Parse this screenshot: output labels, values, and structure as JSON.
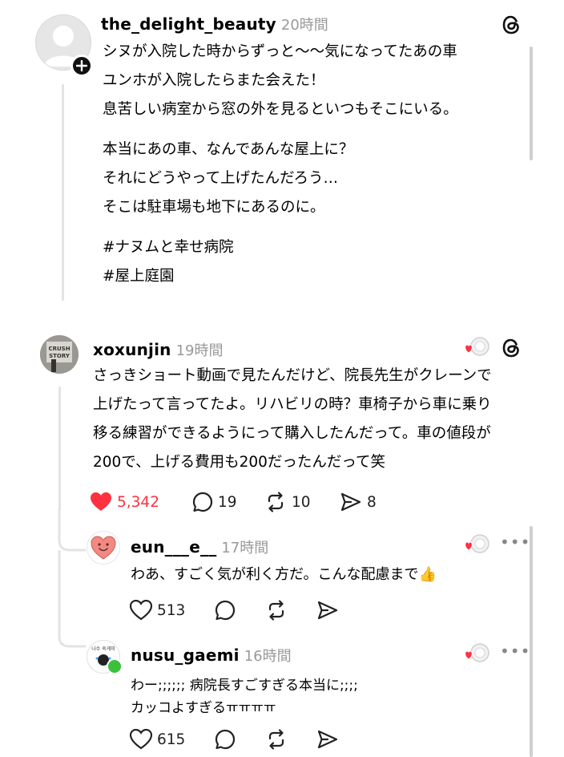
{
  "post": {
    "username": "the_delight_beauty",
    "time": "20時間",
    "paragraphs": [
      [
        "シヌが入院した時からずっと〜〜気になってたあの車",
        "ユンホが入院したらまた会えた！",
        "息苦しい病室から窓の外を見るといつもそこにいる。"
      ],
      [
        "本当にあの車、なんであんな屋上に？",
        "それにどうやって上げたんだろう…",
        "そこは駐車場も地下にあるのに。"
      ],
      [
        "#ナヌムと幸せ病院",
        "#屋上庭園"
      ]
    ]
  },
  "comment": {
    "username": "xoxunjin",
    "time": "19時間",
    "avatar_text": "CRUSH STORY",
    "lines": [
      "さっきショート動画で見たんだけど、院長先生がクレーンで",
      "上げたって言ってたよ。リハビリの時？車椅子から車に乗り",
      "移る練習ができるようにって購入したんだって。車の値段が",
      "200で、上げる費用も200だったんだって笑"
    ],
    "likes": "5,342",
    "replies": "19",
    "reposts": "10",
    "shares": "8"
  },
  "replies": [
    {
      "username": "eun___e__",
      "time": "17時間",
      "lines": [
        "わあ、すごく気が利く方だ。こんな配慮まで👍"
      ],
      "likes": "513"
    },
    {
      "username": "nusu_gaemi",
      "time": "16時間",
      "avatar_text": "나수 숙게미",
      "lines": [
        "わー;;;;;;  病院長すごすぎる本当に;;;;",
        "カッコよすぎるㅠㅠㅠㅠ"
      ],
      "likes": "615"
    }
  ],
  "icons": {
    "threads_logo": "threads-icon",
    "heart": "heart-icon",
    "reply": "reply-icon",
    "repost": "repost-icon",
    "share": "share-icon",
    "more": "more-icon"
  },
  "colors": {
    "like_red": "#ff3040",
    "muted": "#999999",
    "thread_line": "#e3e3e3"
  }
}
